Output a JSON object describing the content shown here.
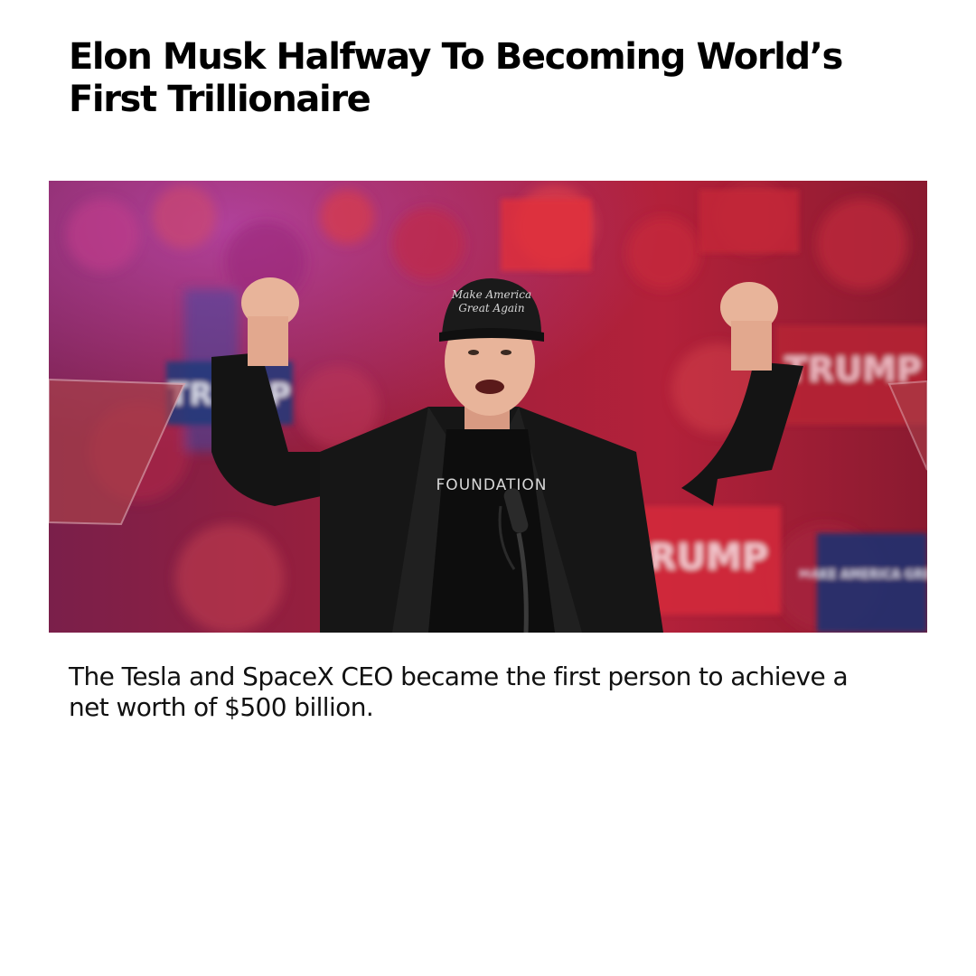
{
  "article": {
    "headline": "Elon Musk Halfway To Becoming World’s First Trillionaire",
    "subheadline": "The Tesla and SpaceX CEO became the first person to achieve a net worth of $500 billion."
  },
  "hero_image": {
    "cap_text_line1": "Make America",
    "cap_text_line2": "Great Again",
    "shirt_text": "FOUNDATION",
    "sign_left": "TRUMP",
    "sign_right_top": "TRUMP",
    "sign_right_bottom": "RUMP",
    "sign_far_right": "MAKE AMERICA GREAT"
  },
  "colors": {
    "background": "#ffffff",
    "headline": "#000000",
    "body_text": "#111111",
    "crowd_red": "#b3213a",
    "crowd_magenta": "#8e2a6e",
    "sign_blue": "#1f3a7a",
    "jacket": "#141414"
  }
}
